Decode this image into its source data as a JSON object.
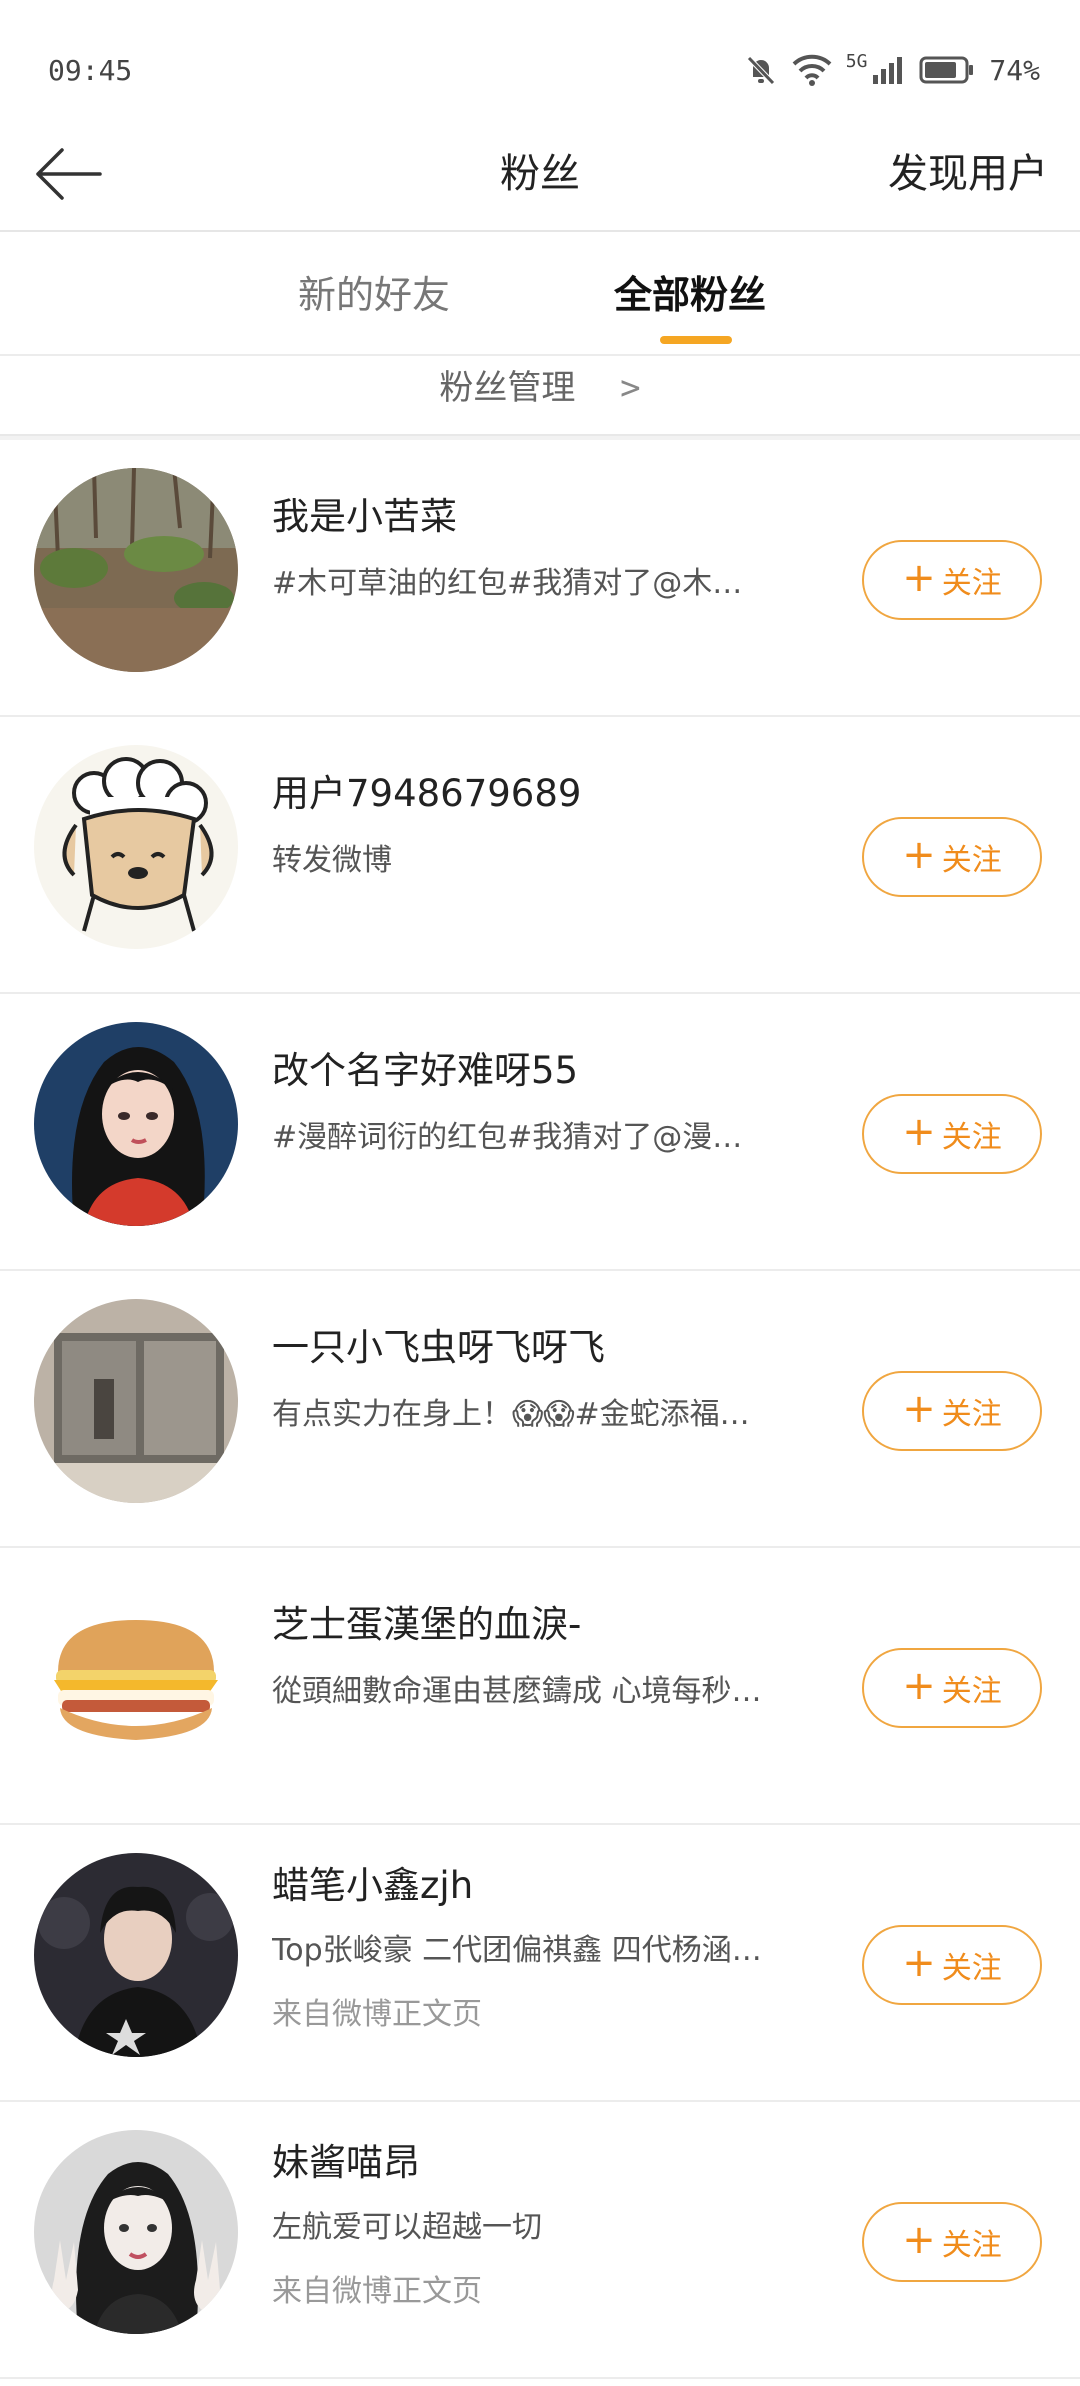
{
  "status_bar": {
    "time": "09:45",
    "network": "5G",
    "battery": "74%"
  },
  "nav": {
    "title": "粉丝",
    "action": "发现用户"
  },
  "tabs": [
    {
      "label": "新的好友"
    },
    {
      "label": "全部粉丝"
    }
  ],
  "manage": {
    "label": "粉丝管理",
    "chevron": ">"
  },
  "follow_label": "关注",
  "accent_color": "#f5a623",
  "fans": [
    {
      "name": "我是小苦菜",
      "desc": "#木可草油的红包#我猜对了@木…",
      "source": ""
    },
    {
      "name": "用户7948679689",
      "desc": "转发微博",
      "source": ""
    },
    {
      "name": "改个名字好难呀55",
      "desc": "#漫醉词衍的红包#我猜对了@漫…",
      "source": ""
    },
    {
      "name": "一只小飞虫呀飞呀飞",
      "desc": "有点实力在身上！😱😱#金蛇添福…",
      "source": ""
    },
    {
      "name": "芝士蛋漢堡的血淚-",
      "desc": "從頭細數命運由甚麼鑄成 心境每秒…",
      "source": ""
    },
    {
      "name": "蜡笔小鑫zjh",
      "desc": "Top张峻豪 二代团偏祺鑫 四代杨涵…",
      "source": "来自微博正文页"
    },
    {
      "name": "妹酱喵昂",
      "desc": "左航爱可以超越一切",
      "source": "来自微博正文页"
    }
  ]
}
